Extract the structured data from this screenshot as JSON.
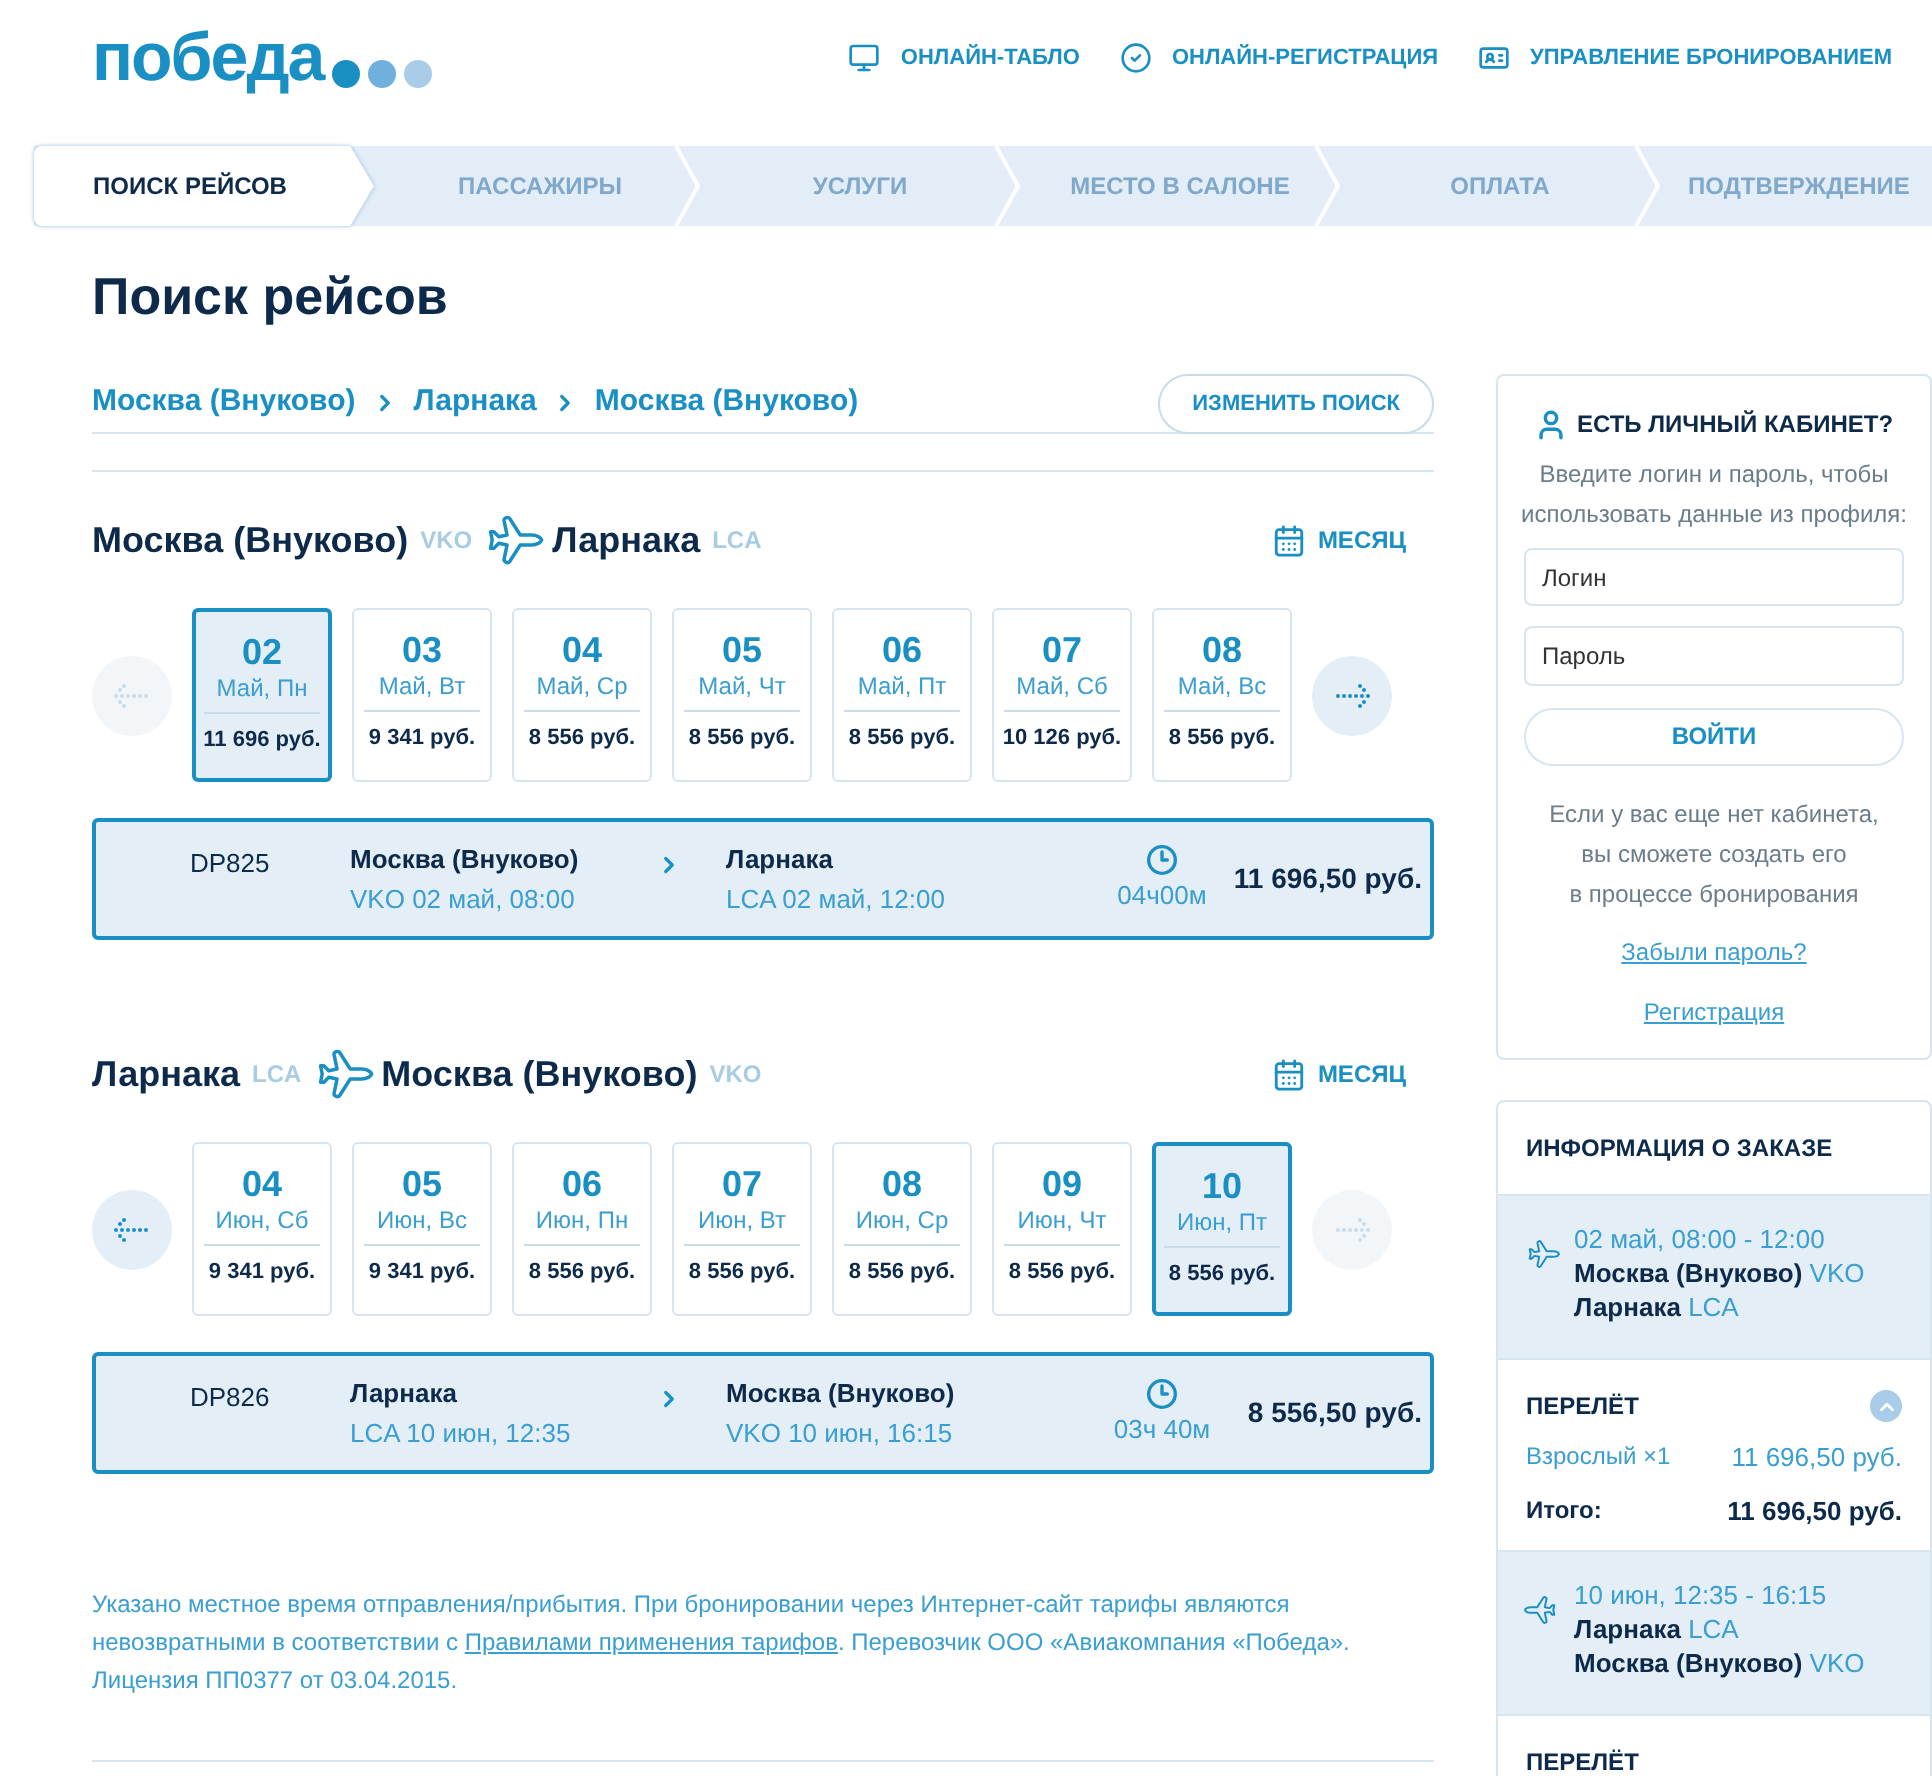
{
  "header": {
    "logo": "победа",
    "nav": [
      {
        "label": "ОНЛАЙН-ТАБЛО",
        "kind": "board"
      },
      {
        "label": "ОНЛАЙН-РЕГИСТРАЦИЯ",
        "kind": "checkin"
      },
      {
        "label": "УПРАВЛЕНИЕ БРОНИРОВАНИЕМ",
        "kind": "booking"
      }
    ]
  },
  "steps": [
    {
      "label": "ПОИСК РЕЙСОВ",
      "selected": true
    },
    {
      "label": "ПАССАЖИРЫ",
      "selected": false
    },
    {
      "label": "УСЛУГИ",
      "selected": false
    },
    {
      "label": "МЕСТО В САЛОНЕ",
      "selected": false
    },
    {
      "label": "ОПЛАТА",
      "selected": false
    },
    {
      "label": "ПОДТВЕРЖДЕНИЕ",
      "selected": false
    }
  ],
  "title": "Поиск рейсов",
  "route": [
    "Москва (Внуково)",
    "Ларнака",
    "Москва (Внуково)"
  ],
  "change_search": "ИЗМЕНИТЬ ПОИСК",
  "legs": [
    {
      "from": {
        "city": "Москва (Внуково)",
        "code": "VKO"
      },
      "to": {
        "city": "Ларнака",
        "code": "LCA"
      },
      "month_button": "МЕСЯЦ",
      "prev_disabled": true,
      "next_disabled": false,
      "dates": [
        {
          "day": "02",
          "label": "Май, Пн",
          "price": "11 696 руб.",
          "selected": true
        },
        {
          "day": "03",
          "label": "Май, Вт",
          "price": "9 341 руб.",
          "selected": false
        },
        {
          "day": "04",
          "label": "Май, Ср",
          "price": "8 556 руб.",
          "selected": false
        },
        {
          "day": "05",
          "label": "Май, Чт",
          "price": "8 556 руб.",
          "selected": false
        },
        {
          "day": "06",
          "label": "Май, Пт",
          "price": "8 556 руб.",
          "selected": false
        },
        {
          "day": "07",
          "label": "Май, Сб",
          "price": "10 126 руб.",
          "selected": false
        },
        {
          "day": "08",
          "label": "Май, Вс",
          "price": "8 556 руб.",
          "selected": false
        }
      ],
      "flight": {
        "number": "DP825",
        "from_city": "Москва (Внуково)",
        "from_detail": "VKO 02 май, 08:00",
        "to_city": "Ларнака",
        "to_detail": "LCA 02 май, 12:00",
        "duration": "04ч00м",
        "price": "11 696,50 руб."
      }
    },
    {
      "from": {
        "city": "Ларнака",
        "code": "LCA"
      },
      "to": {
        "city": "Москва (Внуково)",
        "code": "VKO"
      },
      "month_button": "МЕСЯЦ",
      "prev_disabled": false,
      "next_disabled": true,
      "dates": [
        {
          "day": "04",
          "label": "Июн, Сб",
          "price": "9 341 руб.",
          "selected": false
        },
        {
          "day": "05",
          "label": "Июн, Вс",
          "price": "9 341 руб.",
          "selected": false
        },
        {
          "day": "06",
          "label": "Июн, Пн",
          "price": "8 556 руб.",
          "selected": false
        },
        {
          "day": "07",
          "label": "Июн, Вт",
          "price": "8 556 руб.",
          "selected": false
        },
        {
          "day": "08",
          "label": "Июн, Ср",
          "price": "8 556 руб.",
          "selected": false
        },
        {
          "day": "09",
          "label": "Июн, Чт",
          "price": "8 556 руб.",
          "selected": false
        },
        {
          "day": "10",
          "label": "Июн, Пт",
          "price": "8 556 руб.",
          "selected": true
        }
      ],
      "flight": {
        "number": "DP826",
        "from_city": "Ларнака",
        "from_detail": "LCA 10 июн, 12:35",
        "to_city": "Москва (Внуково)",
        "to_detail": "VKO 10 июн, 16:15",
        "duration": "03ч 40м",
        "price": "8 556,50 руб."
      }
    }
  ],
  "note": {
    "before": "Указано местное время отправления/прибытия. При бронировании через Интернет-сайт тарифы являются невозвратными в соответствии с ",
    "link": "Правилами применения тарифов",
    "after": ". Перевозчик ООО «Авиакомпания «Победа». Лицензия ПП0377 от 03.04.2015."
  },
  "login": {
    "title": "ЕСТЬ ЛИЧНЫЙ КАБИНЕТ?",
    "hint": "Введите логин и пароль, чтобы использовать данные из профиля:",
    "login_placeholder": "Логин",
    "password_placeholder": "Пароль",
    "submit": "ВОЙТИ",
    "info": [
      "Если у вас еще нет кабинета,",
      "вы сможете создать его",
      "в процессе бронирования"
    ],
    "forgot_link": "Забыли пароль?",
    "register_link": "Регистрация"
  },
  "order": {
    "title": "ИНФОРМАЦИЯ О ЗАКАЗЕ",
    "items": [
      {
        "kind": "outbound",
        "time": "02 май, 08:00 - 12:00",
        "from_city": "Москва (Внуково)",
        "from_code": "VKO",
        "to_city": "Ларнака",
        "to_code": "LCA"
      },
      {
        "kind": "fare",
        "title": "ПЕРЕЛЁТ",
        "expanded": true,
        "rows": [
          {
            "label": "Взрослый ×1",
            "value": "11 696,50 руб."
          }
        ],
        "total_label": "Итого:",
        "total_value": "11 696,50 руб."
      },
      {
        "kind": "return",
        "time": "10 июн, 12:35 - 16:15",
        "from_city": "Ларнака",
        "from_code": "LCA",
        "to_city": "Москва (Внуково)",
        "to_code": "VKO"
      },
      {
        "kind": "fare",
        "title": "ПЕРЕЛЁТ"
      }
    ]
  }
}
